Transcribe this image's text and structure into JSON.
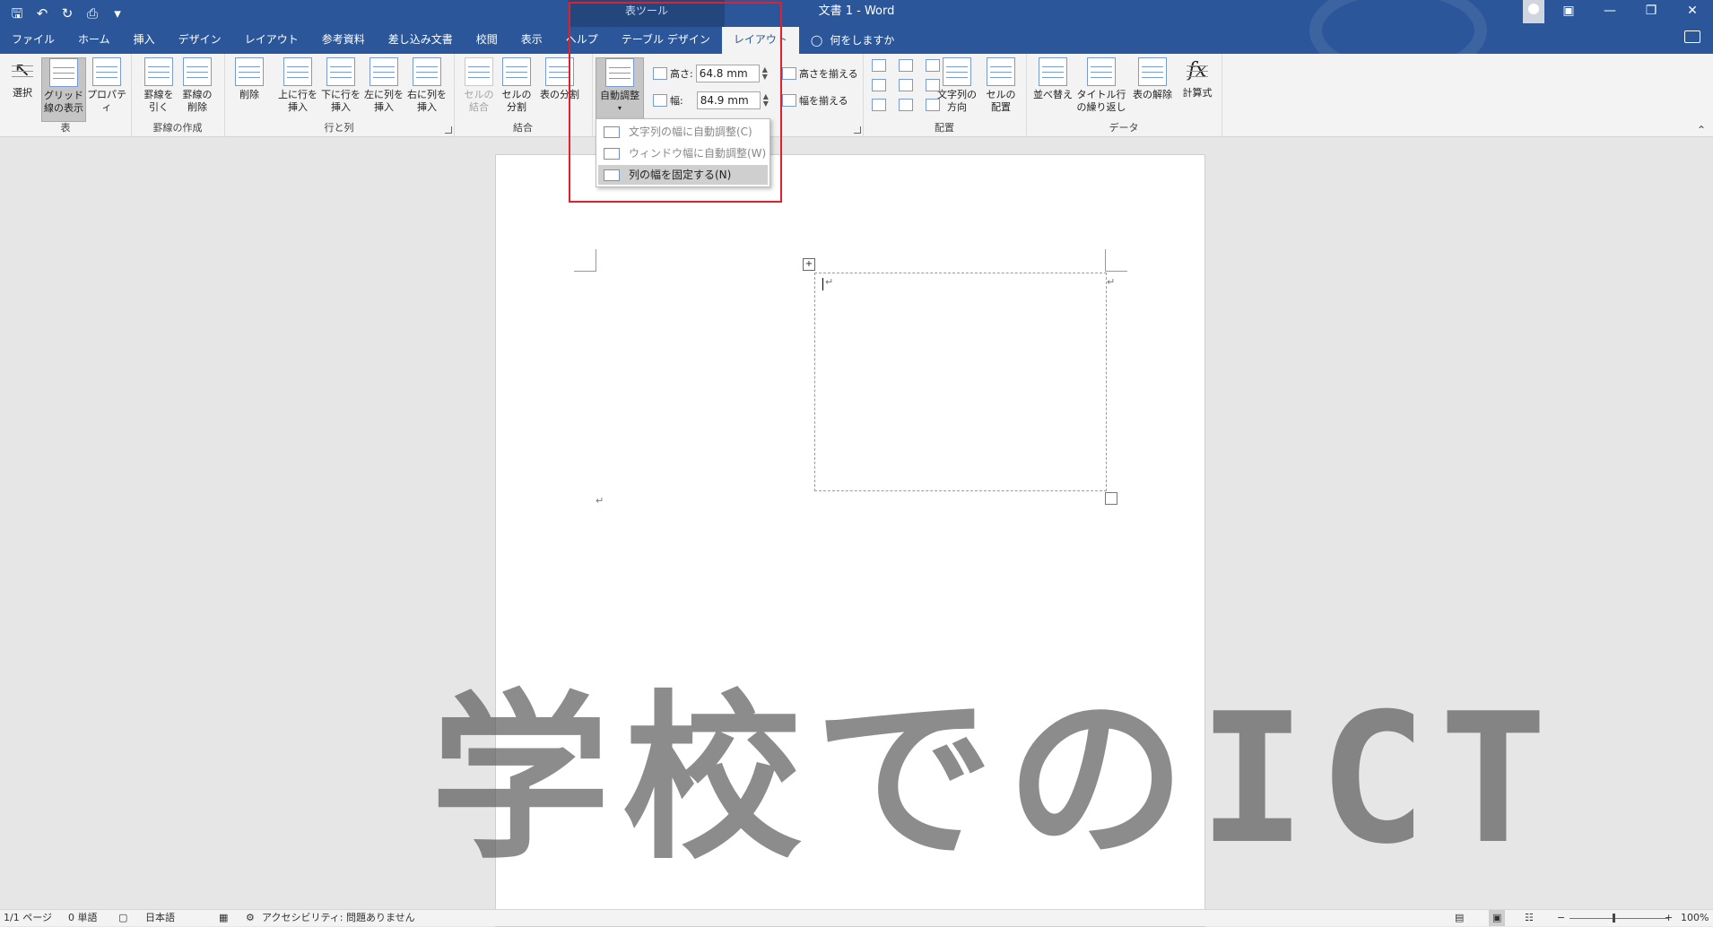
{
  "window": {
    "doc_title": "文書 1  -  Word",
    "context_label": "表ツール"
  },
  "qat": {
    "save_icon": "save-icon",
    "undo_icon": "undo-icon",
    "redo_icon": "redo-icon",
    "preview_icon": "print-preview-icon",
    "customize_icon": "customize-icon"
  },
  "tabs": [
    {
      "label": "ファイル"
    },
    {
      "label": "ホーム"
    },
    {
      "label": "挿入"
    },
    {
      "label": "デザイン"
    },
    {
      "label": "レイアウト"
    },
    {
      "label": "参考資料"
    },
    {
      "label": "差し込み文書"
    },
    {
      "label": "校閲"
    },
    {
      "label": "表示"
    },
    {
      "label": "ヘルプ"
    },
    {
      "label": "テーブル デザイン"
    },
    {
      "label": "レイアウト"
    },
    {
      "label": "何をしますか"
    }
  ],
  "ribbon": {
    "table": {
      "label": "表",
      "select": "選択",
      "gridlines": "グリッド線の表示",
      "properties": "プロパティ"
    },
    "draw": {
      "label": "罫線の作成",
      "draw_table": "罫線を引く",
      "eraser": "罫線の削除"
    },
    "rows_cols": {
      "label": "行と列",
      "delete": "削除",
      "insert_above": "上に行を挿入",
      "insert_below": "下に行を挿入",
      "insert_left": "左に列を挿入",
      "insert_right": "右に列を挿入"
    },
    "merge": {
      "label": "結合",
      "merge_cells": "セルの結合",
      "split_cells": "セルの分割",
      "split_table": "表の分割"
    },
    "cell_size": {
      "autofit": "自動調整",
      "height_label": "高さ:",
      "height_value": "64.8 mm",
      "width_label": "幅:",
      "width_value": "84.9 mm",
      "distribute_rows": "高さを揃える",
      "distribute_cols": "幅を揃える"
    },
    "alignment": {
      "label": "配置",
      "text_direction": "文字列の方向",
      "cell_margins": "セルの配置"
    },
    "data": {
      "label": "データ",
      "sort": "並べ替え",
      "repeat_header": "タイトル行の繰り返し",
      "convert": "表の解除",
      "formula": "計算式"
    }
  },
  "autofit_menu": [
    {
      "label": "文字列の幅に自動調整(C)"
    },
    {
      "label": "ウィンドウ幅に自動調整(W)"
    },
    {
      "label": "列の幅を固定する(N)"
    }
  ],
  "document": {
    "paragraph_mark": "↵",
    "move_handle": "+"
  },
  "watermark": {
    "text": "学校でのICT"
  },
  "statusbar": {
    "page": "1/1 ページ",
    "words": "0 単語",
    "language": "日本語",
    "accessibility": "アクセシビリティ: 問題ありません",
    "zoom": "100%",
    "zoom_minus": "−",
    "zoom_plus": "+"
  },
  "colors": {
    "brand": "#2b579a",
    "highlight": "#e0202a"
  }
}
